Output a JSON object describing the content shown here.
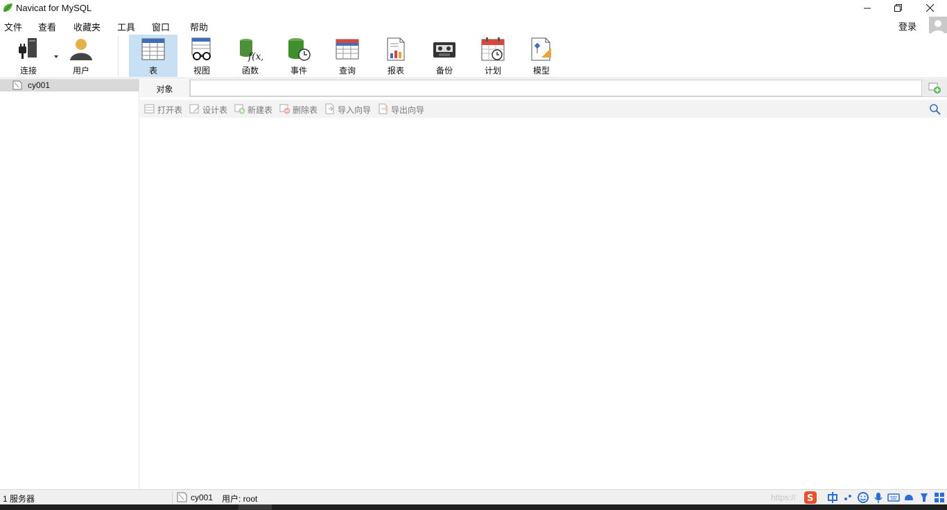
{
  "window": {
    "title": "Navicat for MySQL"
  },
  "menu": {
    "items": [
      "文件",
      "查看",
      "收藏夹",
      "工具",
      "窗口",
      "帮助"
    ],
    "login": "登录"
  },
  "toolbar": {
    "connect": "连接",
    "user": "用户",
    "table": "表",
    "view": "视图",
    "function": "函数",
    "event": "事件",
    "query": "查询",
    "report": "报表",
    "backup": "备份",
    "schedule": "计划",
    "model": "模型"
  },
  "sidebar": {
    "connection": "cy001"
  },
  "main": {
    "tab_objects": "对象",
    "subtoolbar": {
      "open_table": "打开表",
      "design_table": "设计表",
      "new_table": "新建表",
      "delete_table": "删除表",
      "import_wizard": "导入向导",
      "export_wizard": "导出向导"
    }
  },
  "status": {
    "servers": "1 服务器",
    "connection": "cy001",
    "user": "用户: root",
    "watermark": "https://"
  },
  "colors": {
    "active_tool": "#c7e0f4",
    "accent_green": "#3a9a3a",
    "accent_red": "#d9463c"
  }
}
